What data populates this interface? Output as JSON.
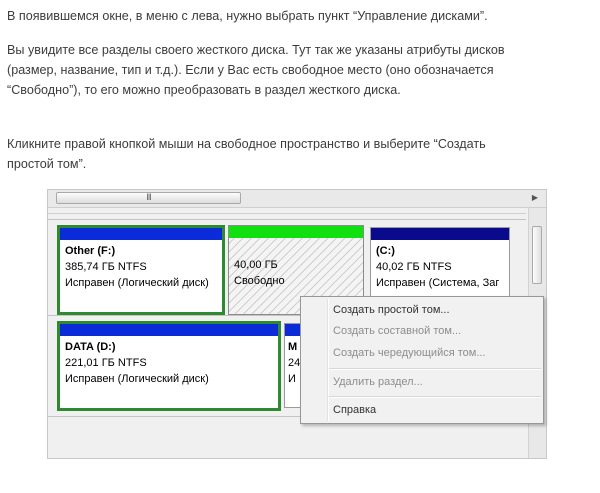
{
  "article": {
    "p1": "В появившемся окне, в меню с лева, нужно выбрать пункт “Управление дисками”.",
    "p2": [
      "Вы увидите все разделы своего жесткого диска. Тут так же указаны атрибуты дисков",
      "(размер, название, тип и т.д.). Если у Вас есть свободное место (оно обозначается",
      "“Свободно”), то его можно преобразовать в раздел жесткого диска."
    ],
    "p3": [
      "Кликните правой кнопкой мыши на свободное пространство и  выберите “Создать",
      "простой том”."
    ]
  },
  "disk_management": {
    "scroll_thumb_glyph": "III",
    "scroll_arrow_glyph": "▶",
    "partitions": {
      "other": {
        "name": "Other  (F:)",
        "size": "385,74 ГБ NTFS",
        "status": "Исправен (Логический диск)",
        "bar_color": "#0b2bd8"
      },
      "free": {
        "size": "40,00 ГБ",
        "status": "Свободно",
        "bar_color": "#10e010"
      },
      "c": {
        "name": "(C:)",
        "size": "40,02 ГБ NTFS",
        "status": "Исправен (Система, Заг",
        "bar_color": "#0a0a8c"
      },
      "data": {
        "name": "DATA  (D:)",
        "size": "221,01 ГБ NTFS",
        "status": "Исправен (Логический диск)",
        "bar_color": "#0b2bd8"
      },
      "m": {
        "name": "M",
        "size": "24",
        "status": "И",
        "bar_color": "#0b2bd8"
      }
    },
    "context_menu": {
      "create_simple": "Создать простой том...",
      "create_spanned": "Создать составной том...",
      "create_striped": "Создать чередующийся том...",
      "delete_partition": "Удалить раздел...",
      "help": "Справка"
    }
  }
}
